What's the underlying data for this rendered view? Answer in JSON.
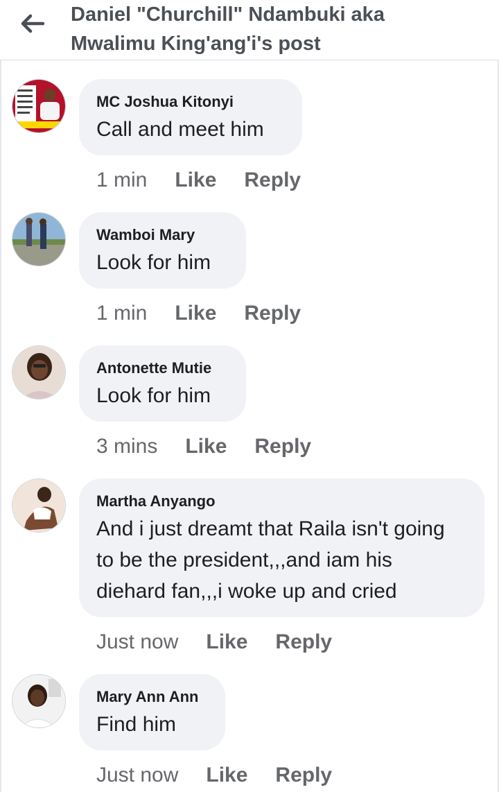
{
  "header": {
    "title_line1": "Daniel \"Churchill\" Ndambuki aka",
    "title_line2": "Mwalimu King'ang'i's post"
  },
  "comments": [
    {
      "author": "MC Joshua Kitonyi",
      "text": "Call and meet him",
      "time": "1 min",
      "like": "Like",
      "reply": "Reply"
    },
    {
      "author": "Wamboi Mary",
      "text": "Look for him",
      "time": "1 min",
      "like": "Like",
      "reply": "Reply"
    },
    {
      "author": "Antonette Mutie",
      "text": "Look for him",
      "time": "3 mins",
      "like": "Like",
      "reply": "Reply"
    },
    {
      "author": "Martha Anyango",
      "text": "And i just dreamt that Raila isn't going to be the president,,,and iam his diehard fan,,,i woke up and cried",
      "time": "Just now",
      "like": "Like",
      "reply": "Reply"
    },
    {
      "author": "Mary Ann Ann",
      "text": "Find him",
      "time": "Just now",
      "like": "Like",
      "reply": "Reply"
    }
  ],
  "colors": {
    "bubble": "#f0f2f5",
    "text": "#1c1e21",
    "secondary": "#65676b",
    "header_text": "#4b4f56"
  }
}
